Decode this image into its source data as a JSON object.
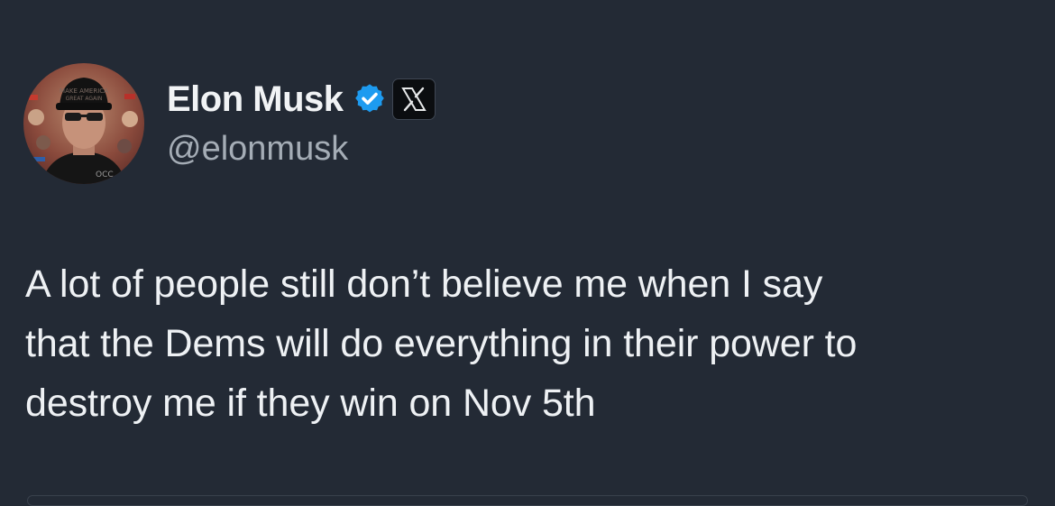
{
  "author": {
    "display_name": "Elon Musk",
    "handle": "@elonmusk",
    "verified_icon": "verified-badge-icon",
    "affiliate_icon": "x-logo-icon",
    "avatar_icon": "profile-photo"
  },
  "tweet": {
    "text_lines": [
      "A lot of people still don’t believe me when I say",
      "that the Dems will do everything in their power to",
      "destroy me if they win on Nov 5th"
    ]
  },
  "colors": {
    "background": "#232a35",
    "verified_blue": "#1d9bf0",
    "text_primary": "#eef1f4",
    "text_secondary": "#a5adb6"
  }
}
